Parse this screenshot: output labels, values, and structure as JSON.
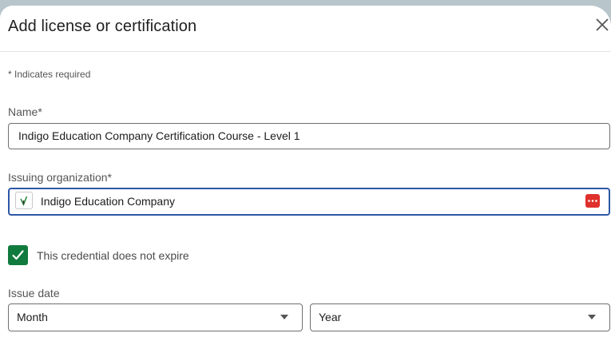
{
  "dialog": {
    "title": "Add license or certification",
    "required_note": "* Indicates required"
  },
  "form": {
    "name": {
      "label": "Name*",
      "value": "Indigo Education Company Certification Course - Level 1"
    },
    "issuing_org": {
      "label": "Issuing organization*",
      "value": "Indigo Education Company"
    },
    "no_expire": {
      "label": "This credential does not expire",
      "checked": true
    },
    "issue_date": {
      "label": "Issue date",
      "month": "Month",
      "year": "Year"
    }
  },
  "colors": {
    "accent_focus": "#2d56a6",
    "checkbox_green": "#117a3e",
    "extension_badge": "#e0302b"
  },
  "icons": {
    "close": "close-icon",
    "org_logo": "org-logo-icon",
    "extension": "password-manager-icon",
    "check": "checkmark-icon",
    "caret": "caret-down-icon"
  }
}
